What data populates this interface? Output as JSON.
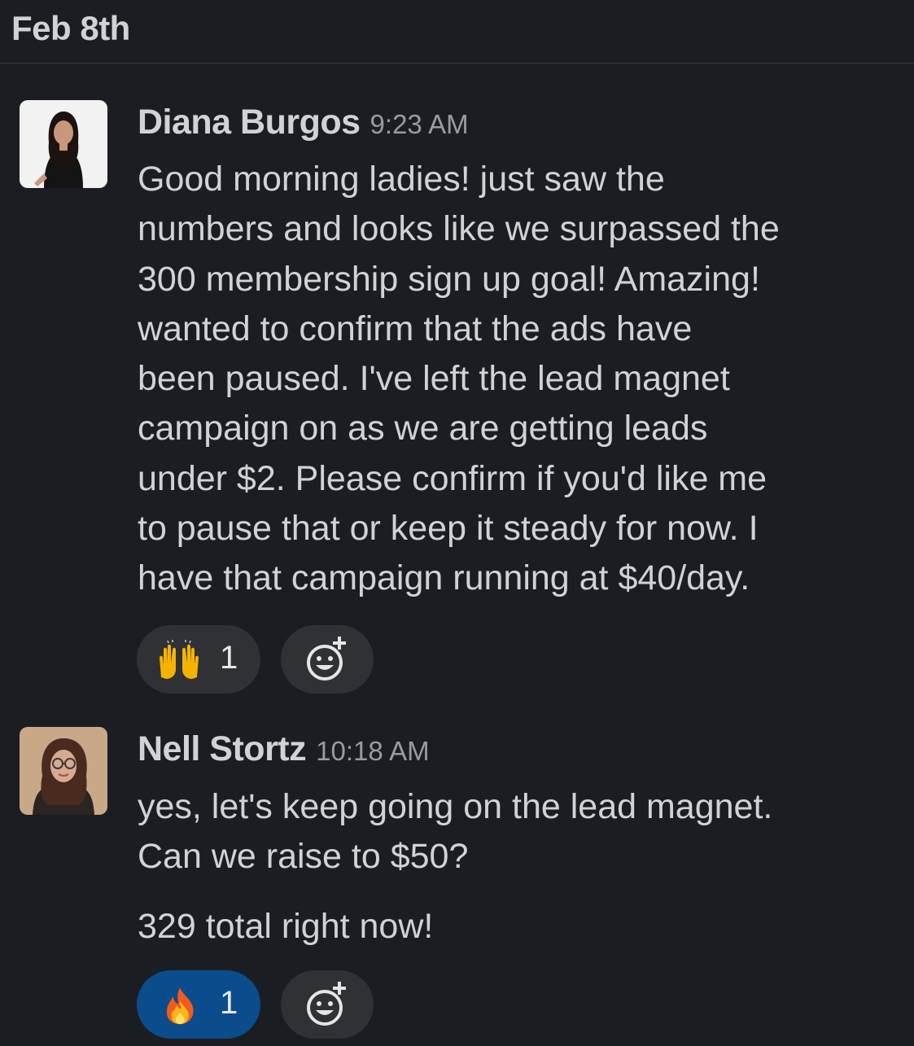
{
  "day_divider": {
    "label": "Feb 8th"
  },
  "messages": [
    {
      "sender": "Diana Burgos",
      "time": "9:23 AM",
      "lines": [
        "Good morning ladies! just saw the",
        "numbers and looks like we surpassed the",
        "300 membership sign up goal! Amazing!",
        "wanted to confirm that the ads have",
        "been paused. I've left the lead magnet",
        "campaign on as we are getting leads",
        "under $2. Please confirm if you'd like me",
        "to pause that or keep it steady for now.  I",
        "have that campaign running at $40/day."
      ],
      "reaction": {
        "emoji": "raised-hands-icon",
        "count": "1",
        "active": false
      }
    },
    {
      "sender": "Nell Stortz",
      "time": "10:18 AM",
      "lines": [
        "yes, let's keep going on the lead magnet.",
        "Can we raise to $50?"
      ],
      "second_paragraph": "329 total right now!",
      "reaction": {
        "emoji": "fire-icon",
        "count": "1",
        "active": true,
        "accent": "#0b4c8c"
      }
    }
  ],
  "colors": {
    "background": "#1a1d21",
    "text": "#d1d2d3",
    "muted": "#9a9b9e",
    "reaction_bg": "#2f3135",
    "reaction_active_bg": "#0b4c8c"
  }
}
